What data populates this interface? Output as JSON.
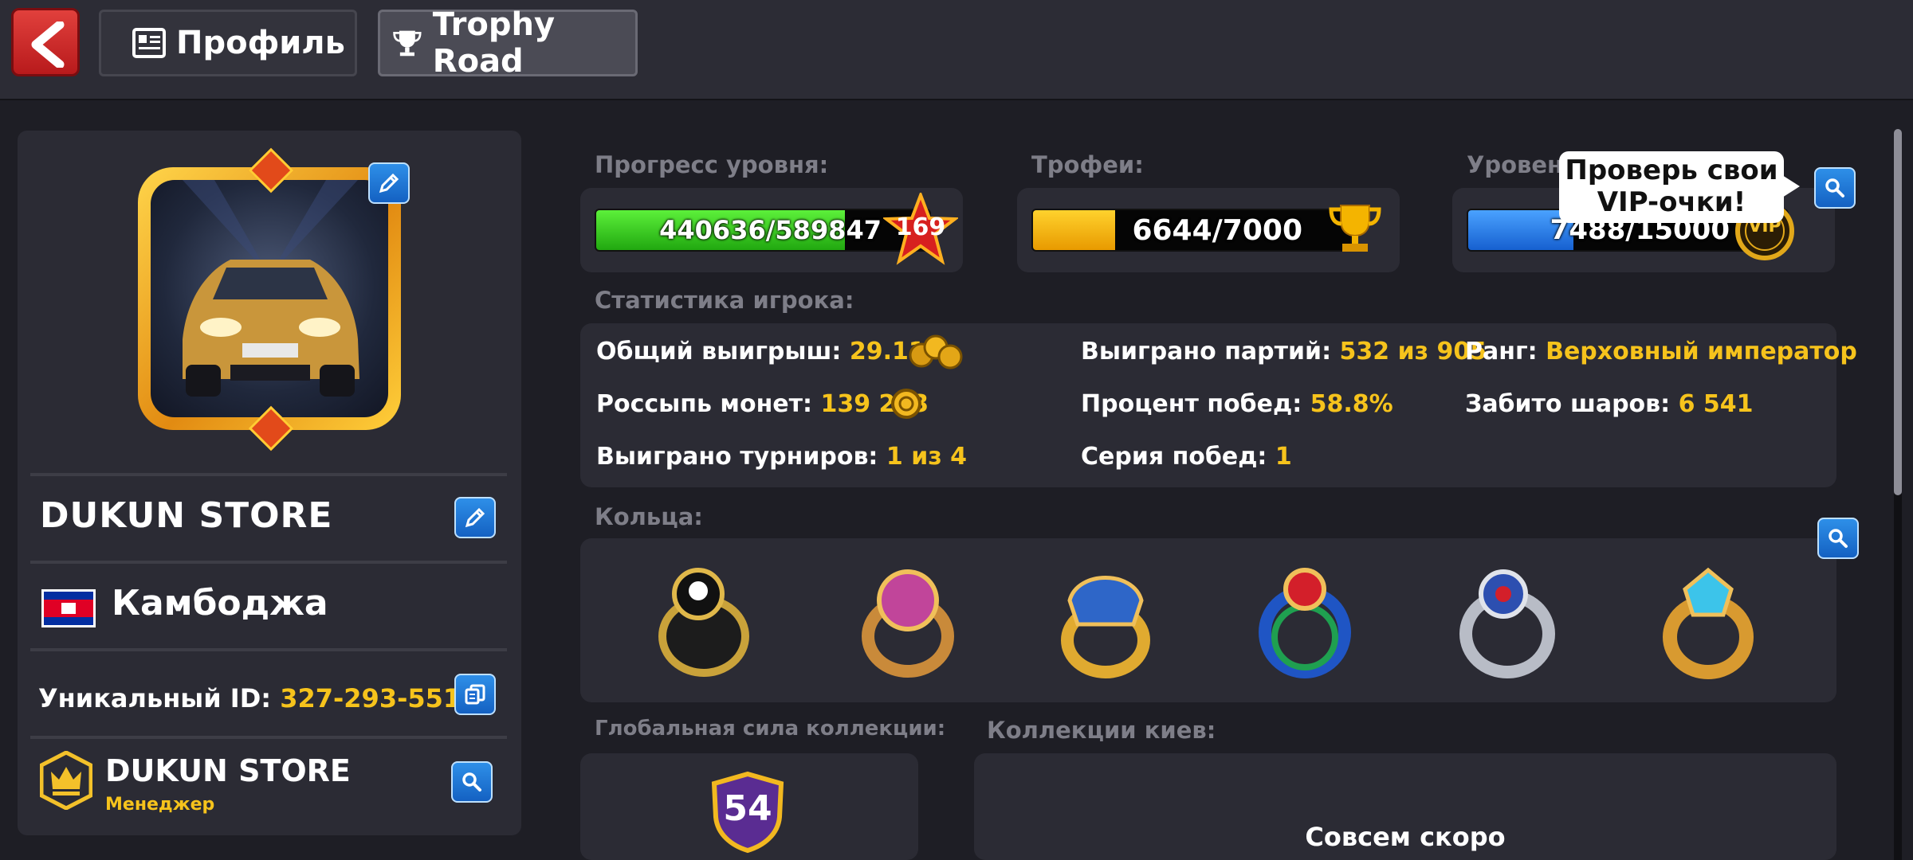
{
  "header": {
    "tabs": [
      {
        "label": "Профиль",
        "icon": "profile-card-icon"
      },
      {
        "label": "Trophy Road",
        "icon": "trophy-icon"
      }
    ]
  },
  "profile": {
    "name": "DUKUN STORE",
    "country": "Камбоджа",
    "uid_label": "Уникальный ID:",
    "uid_value": "327-293-551-7",
    "club": {
      "name": "DUKUN STORE",
      "role": "Менеджер"
    }
  },
  "progress": {
    "level": {
      "label": "Прогресс уровня:",
      "value_text": "440636/589847",
      "fill": 0.747,
      "level": "169"
    },
    "trophies": {
      "label": "Трофеи:",
      "value_text": "6644/7000",
      "fill": 0.26
    },
    "vip": {
      "label": "Уровень VIP:",
      "value_text": "7488/15000",
      "fill": 0.33,
      "badge": "VIP"
    }
  },
  "tooltip": {
    "line1": "Проверь свои",
    "line2": "VIP-очки!"
  },
  "stats": {
    "label": "Статистика игрока:",
    "total_win": {
      "label": "Общий выигрыш:",
      "value": "29.11B"
    },
    "coin_scatter": {
      "label": "Россыпь монет:",
      "value": "139 223"
    },
    "tournaments": {
      "label": "Выиграно турниров:",
      "value": "1 из 4"
    },
    "games_won": {
      "label": "Выиграно партий:",
      "value": "532 из 905"
    },
    "win_pct": {
      "label": "Процент побед:",
      "value": "58.8%"
    },
    "streak": {
      "label": "Серия побед:",
      "value": "1"
    },
    "rank": {
      "label": "Ранг:",
      "value": "Верховный император"
    },
    "balls": {
      "label": "Забито шаров:",
      "value": "6 541"
    }
  },
  "rings": {
    "label": "Кольца:"
  },
  "collection": {
    "label": "Глобальная сила коллекции:",
    "value": "54"
  },
  "cues": {
    "label": "Коллекции киев:",
    "status": "Совсем скоро"
  },
  "colors": {
    "accent_yellow": "#f6c31c",
    "level_green": "#3ad21e",
    "trophy_gold": "#f5b400",
    "vip_blue": "#2a7ee6"
  }
}
